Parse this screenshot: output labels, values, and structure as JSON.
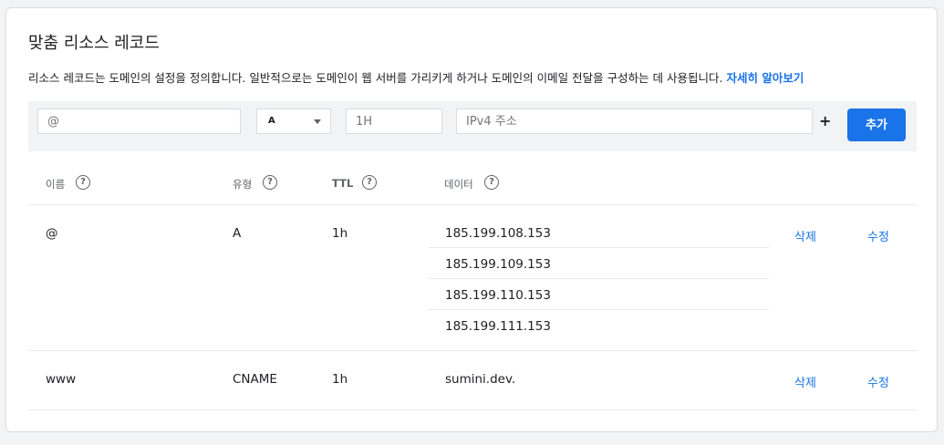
{
  "title": "맞춤 리소스 레코드",
  "description": {
    "text": "리소스 레코드는 도메인의 설정을 정의합니다. 일반적으로는 도메인이 웹 서버를 가리키게 하거나 도메인의 이메일 전달을 구성하는 데 사용됩니다.",
    "link": "자세히 알아보기"
  },
  "add_form": {
    "name_placeholder": "@",
    "type_value": "A",
    "ttl_placeholder": "1H",
    "data_placeholder": "IPv4 주소",
    "plus_symbol": "+",
    "add_label": "추가"
  },
  "table": {
    "headers": {
      "name": "이름",
      "type": "유형",
      "ttl": "TTL",
      "data": "데이터"
    },
    "help_symbol": "?",
    "rows": [
      {
        "name": "@",
        "type": "A",
        "ttl": "1h",
        "data": [
          "185.199.108.153",
          "185.199.109.153",
          "185.199.110.153",
          "185.199.111.153"
        ],
        "delete_label": "삭제",
        "edit_label": "수정"
      },
      {
        "name": "www",
        "type": "CNAME",
        "ttl": "1h",
        "data": [
          "sumini.dev."
        ],
        "delete_label": "삭제",
        "edit_label": "수정"
      }
    ]
  },
  "colors": {
    "accent": "#1a73e8",
    "text": "#202124",
    "muted": "#5f6368",
    "bar_bg": "#f1f3f4"
  }
}
